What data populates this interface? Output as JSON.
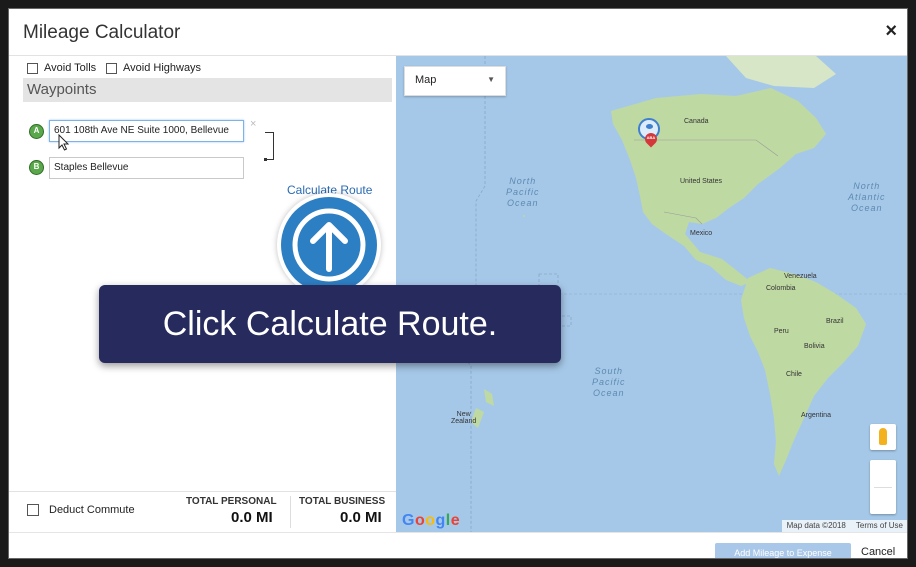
{
  "dialog": {
    "title": "Mileage Calculator",
    "close_label": "×"
  },
  "options": {
    "avoid_tolls": "Avoid Tolls",
    "avoid_highways": "Avoid Highways"
  },
  "waypoints": {
    "header": "Waypoints",
    "items": [
      {
        "badge": "A",
        "value": "601 108th Ave NE Suite 1000, Bellevue"
      },
      {
        "badge": "B",
        "value": "Staples Bellevue"
      }
    ],
    "remove_label": "×",
    "calculate_link": "Calculate Route"
  },
  "totals": {
    "deduct_commute": "Deduct Commute",
    "personal_label": "TOTAL PERSONAL",
    "personal_value": "0.0 MI",
    "business_label": "TOTAL BUSINESS",
    "business_value": "0.0 MI"
  },
  "map": {
    "type_select": "Map",
    "labels": {
      "canada": "Canada",
      "united_states": "United States",
      "mexico": "Mexico",
      "venezuela": "Venezuela",
      "colombia": "Colombia",
      "peru": "Peru",
      "brazil": "Brazil",
      "bolivia": "Bolivia",
      "chile": "Chile",
      "argentina": "Argentina",
      "new_zealand": "New\nZealand",
      "north_pacific": "North\nPacific\nOcean",
      "south_pacific": "South\nPacific\nOcean",
      "north_atlantic": "North\nAtlantic\nOcean"
    },
    "pin_marker_text": "ABA",
    "google": "Google",
    "map_data": "Map data ©2018",
    "terms": "Terms of Use"
  },
  "footer": {
    "add_button": "Add Mileage to Expense",
    "cancel": "Cancel"
  },
  "overlay": {
    "instruction_prefix": "Click ",
    "instruction_bold": "Calculate Route."
  },
  "colors": {
    "ocean": "#a6c8e8",
    "land": "#bfd9a3",
    "link": "#2a6ab3",
    "banner": "#262a5d",
    "circle": "#2d7fc3"
  }
}
